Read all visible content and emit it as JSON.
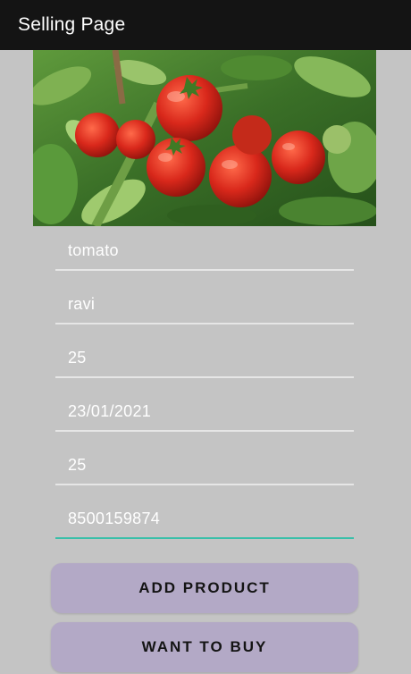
{
  "app_bar": {
    "title": "Selling Page"
  },
  "product_image": {
    "icon": "tomato-plant-photo"
  },
  "form": {
    "fields": [
      {
        "value": "tomato"
      },
      {
        "value": "ravi"
      },
      {
        "value": "25"
      },
      {
        "value": "23/01/2021"
      },
      {
        "value": "25"
      },
      {
        "value": "8500159874"
      }
    ]
  },
  "buttons": {
    "add_product": "ADD PRODUCT",
    "want_to_buy": "WANT TO BUY"
  },
  "colors": {
    "app_bar_bg": "#141414",
    "background": "#c4c4c4",
    "button_bg": "#b3a9c6",
    "focus_underline": "#39bfa9"
  }
}
